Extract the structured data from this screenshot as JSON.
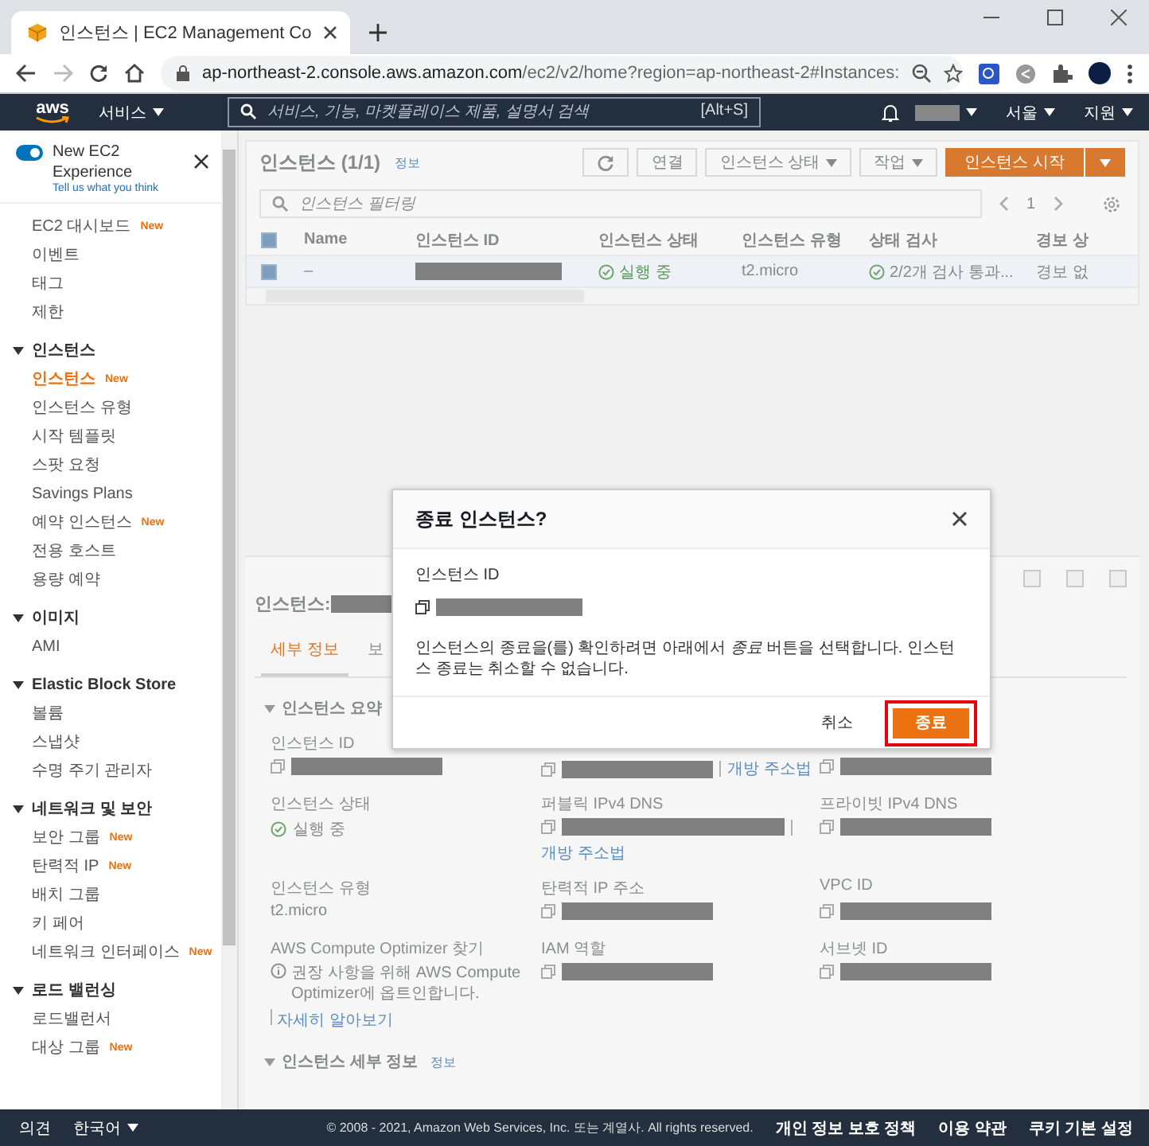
{
  "browser": {
    "tab_title": "인스턴스 | EC2 Management Co",
    "url_host": "ap-northeast-2.console.aws.amazon.com",
    "url_path": "/ec2/v2/home?region=ap-northeast-2#Instances:"
  },
  "topnav": {
    "logo": "aws",
    "services": "서비스",
    "search_placeholder": "서비스, 기능, 마켓플레이스 제품, 설명서 검색",
    "shortcut": "[Alt+S]",
    "region": "서울",
    "support": "지원"
  },
  "sidebar": {
    "toggle": {
      "title": "New EC2 Experience",
      "on": true,
      "link": "Tell us what you think"
    },
    "groups": [
      {
        "items": [
          {
            "label": "EC2 대시보드",
            "badge": "New",
            "selected": false
          },
          {
            "label": "이벤트",
            "selected": false
          },
          {
            "label": "태그",
            "selected": false
          },
          {
            "label": "제한",
            "selected": false
          }
        ]
      },
      {
        "title": "인스턴스",
        "expanded": true,
        "items": [
          {
            "label": "인스턴스",
            "badge": "New",
            "selected": true
          },
          {
            "label": "인스턴스 유형",
            "selected": false
          },
          {
            "label": "시작 템플릿",
            "selected": false
          },
          {
            "label": "스팟 요청",
            "selected": false
          },
          {
            "label": "Savings Plans",
            "selected": false
          },
          {
            "label": "예약 인스턴스",
            "badge": "New",
            "selected": false
          },
          {
            "label": "전용 호스트",
            "selected": false
          },
          {
            "label": "용량 예약",
            "selected": false
          }
        ]
      },
      {
        "title": "이미지",
        "expanded": true,
        "items": [
          {
            "label": "AMI",
            "selected": false
          }
        ]
      },
      {
        "title": "Elastic Block Store",
        "expanded": true,
        "items": [
          {
            "label": "볼륨",
            "selected": false
          },
          {
            "label": "스냅샷",
            "selected": false
          },
          {
            "label": "수명 주기 관리자",
            "selected": false
          }
        ]
      },
      {
        "title": "네트워크 및 보안",
        "expanded": true,
        "items": [
          {
            "label": "보안 그룹",
            "badge": "New",
            "selected": false
          },
          {
            "label": "탄력적 IP",
            "badge": "New",
            "selected": false
          },
          {
            "label": "배치 그룹",
            "selected": false
          },
          {
            "label": "키 페어",
            "selected": false
          },
          {
            "label": "네트워크 인터페이스",
            "badge": "New",
            "selected": false
          }
        ]
      },
      {
        "title": "로드 밸런싱",
        "expanded": true,
        "items": [
          {
            "label": "로드밸런서",
            "selected": false
          },
          {
            "label": "대상 그룹",
            "badge": "New",
            "selected": false
          }
        ]
      }
    ]
  },
  "instances": {
    "title": "인스턴스",
    "count": "(1/1)",
    "info": "정보",
    "buttons": [
      {
        "label": "연결",
        "dropdown": false
      },
      {
        "label": "인스턴스 상태",
        "dropdown": true
      },
      {
        "label": "작업",
        "dropdown": true
      }
    ],
    "primary": "인스턴스 시작",
    "filter_placeholder": "인스턴스 필터링",
    "page": "1",
    "all_checked": true,
    "columns": [
      "Name",
      "인스턴스 ID",
      "인스턴스 상태",
      "인스턴스 유형",
      "상태 검사",
      "경보 상"
    ],
    "rows": [
      {
        "checked": true,
        "name": "–",
        "state": "실행 중",
        "type": "t2.micro",
        "status_check": "2/2개 검사 통과...",
        "alarm": "경보 없"
      }
    ]
  },
  "details": {
    "title": "인스턴스:",
    "tabs": [
      {
        "label": "세부 정보",
        "selected": true
      },
      {
        "label": "보",
        "selected": false
      }
    ],
    "section": "인스턴스 요약",
    "fields": [
      {
        "label": "인스턴스 ID",
        "kind": "redacted"
      },
      {
        "kind": "redacted",
        "link": "개방 주소법"
      },
      {
        "kind": "redacted"
      },
      {
        "label": "인스턴스 상태",
        "kind": "status",
        "value": "실행 중"
      },
      {
        "label": "퍼블릭 IPv4 DNS",
        "kind": "redacted",
        "link": "개방 주소법"
      },
      {
        "label": "프라이빗 IPv4 DNS",
        "kind": "redacted"
      },
      {
        "label": "인스턴스 유형",
        "kind": "text",
        "value": "t2.micro"
      },
      {
        "label": "탄력적 IP 주소",
        "kind": "redacted"
      },
      {
        "label": "VPC ID",
        "kind": "redacted"
      },
      {
        "label": "AWS Compute Optimizer 찾기",
        "kind": "note",
        "value": "권장 사항을 위해 AWS Compute Optimizer에 옵트인합니다.",
        "link": "자세히 알아보기"
      },
      {
        "label": "IAM 역할",
        "kind": "redacted"
      },
      {
        "label": "서브넷 ID",
        "kind": "redacted"
      }
    ],
    "next_section": "인스턴스 세부 정보",
    "next_info": "정보"
  },
  "dialog": {
    "title": "종료 인스턴스?",
    "field_label": "인스턴스 ID",
    "message": "인스턴스의 종료을(를) 확인하려면 아래에서 *종료* 버튼을 선택합니다. 인스턴스 종료는 취소할 수 없습니다.",
    "cancel": "취소",
    "confirm": "종료",
    "confirm_highlighted": true
  },
  "footer": {
    "feedback": "의견",
    "language": "한국어",
    "copyright": "© 2008 - 2021, Amazon Web Services, Inc. 또는 계열사. All rights reserved.",
    "links": [
      "개인 정보 보호 정책",
      "이용 약관",
      "쿠키 기본 설정"
    ]
  }
}
